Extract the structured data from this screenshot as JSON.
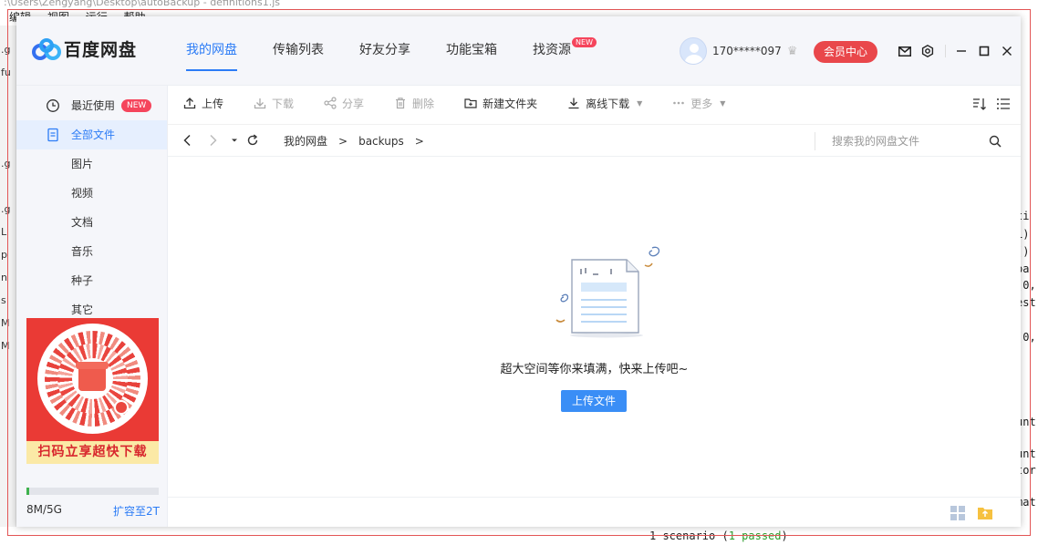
{
  "background": {
    "title": ":\\Users\\Zengyang\\Desktop\\autoBackup - definitions1.js",
    "menu": [
      "编辑",
      "视图",
      "运行",
      "帮助"
    ],
    "left_items": [
      ".g",
      "fu",
      "",
      "",
      "",
      ".g",
      "",
      ".g",
      "L",
      "p",
      "n",
      "s",
      "M",
      "M"
    ],
    "right_lines": [
      "ti",
      "1)",
      "()",
      "pa",
      "(0,",
      "est",
      "(0,",
      "unt",
      "unt",
      "tor",
      "mat"
    ],
    "terminal": {
      "prefix": "1 scenario (",
      "passed": "1 passed",
      "suffix": ")"
    }
  },
  "app": {
    "name": "百度网盘",
    "brand_color": "#2c7cf6",
    "nav": [
      {
        "label": "我的网盘",
        "active": true
      },
      {
        "label": "传输列表",
        "active": false
      },
      {
        "label": "好友分享",
        "active": false
      },
      {
        "label": "功能宝箱",
        "active": false
      },
      {
        "label": "找资源",
        "active": false,
        "badge": "NEW"
      }
    ],
    "user": {
      "name": "170*****097",
      "vip_button": "会员中心"
    },
    "window_icons": [
      "mail-icon",
      "settings-icon",
      "minimize-icon",
      "maximize-icon",
      "close-icon"
    ]
  },
  "sidebar": {
    "items": [
      {
        "label": "最近使用",
        "icon": "clock-icon",
        "badge": "NEW"
      },
      {
        "label": "全部文件",
        "icon": "file-icon",
        "active": true
      },
      {
        "label": "图片"
      },
      {
        "label": "视频"
      },
      {
        "label": "文档"
      },
      {
        "label": "音乐"
      },
      {
        "label": "种子"
      },
      {
        "label": "其它"
      }
    ],
    "promo": {
      "text": "扫码立享超快下载"
    },
    "quota": {
      "used": "8M/5G",
      "expand": "扩容至2T",
      "fraction": 0.02
    }
  },
  "toolbar": {
    "upload": "上传",
    "download": "下载",
    "share": "分享",
    "delete": "删除",
    "new_folder": "新建文件夹",
    "offline_download": "离线下载",
    "more": "更多"
  },
  "address": {
    "crumbs": [
      "我的网盘",
      "backups"
    ],
    "search_placeholder": "搜索我的网盘文件"
  },
  "empty": {
    "message": "超大空间等你来填满，快来上传吧~",
    "upload_button": "上传文件"
  }
}
